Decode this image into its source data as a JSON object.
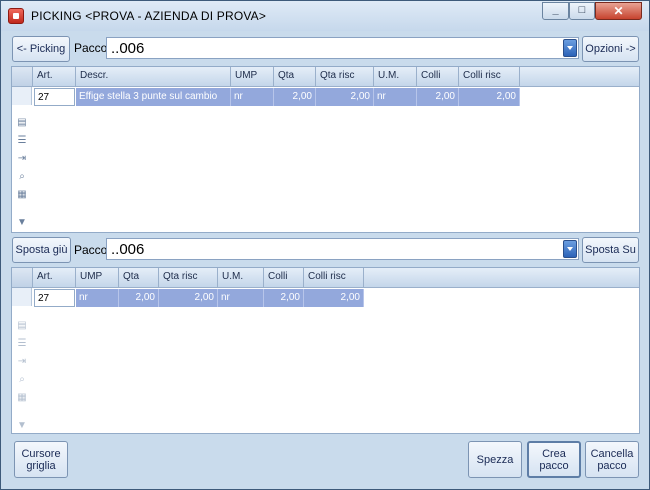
{
  "window": {
    "title": "PICKING <PROVA - AZIENDA DI PROVA>",
    "controls": {
      "minimize": "_",
      "maximize": "□",
      "close": "✕"
    }
  },
  "top": {
    "back_button": "<- Picking",
    "pacco_label": "Pacco",
    "pacco_value": "..006",
    "options_button": "Opzioni ->",
    "grid": {
      "columns": [
        "Art.",
        "Descr.",
        "UMP",
        "Qta",
        "Qta risc",
        "U.M.",
        "Colli",
        "Colli risc"
      ],
      "rows": [
        {
          "art": "27",
          "descr": "Effige stella 3 punte sul cambio",
          "ump": "nr",
          "qta": "2,00",
          "qta_risc": "2,00",
          "um": "nr",
          "colli": "2,00",
          "colli_risc": "2,00"
        }
      ]
    },
    "toolbar_icons": [
      "table-icon",
      "list-icon",
      "insert-icon",
      "search-icon",
      "columns-icon",
      "filter-icon"
    ]
  },
  "middle": {
    "move_down_button": "Sposta giù",
    "pacco_label": "Pacco",
    "pacco_value": "..006",
    "move_up_button": "Sposta Su"
  },
  "bottom": {
    "grid": {
      "columns": [
        "Art.",
        "UMP",
        "Qta",
        "Qta risc",
        "U.M.",
        "Colli",
        "Colli risc"
      ],
      "rows": [
        {
          "art": "27",
          "ump": "nr",
          "qta": "2,00",
          "qta_risc": "2,00",
          "um": "nr",
          "colli": "2,00",
          "colli_risc": "2,00"
        }
      ]
    },
    "toolbar_icons": [
      "table-icon",
      "list-icon",
      "insert-icon",
      "search-icon",
      "columns-icon",
      "filter-icon"
    ]
  },
  "footer": {
    "cursor_grid_button": "Cursore\ngriglia",
    "split_button": "Spezza",
    "create_pack_button": "Crea\npacco",
    "delete_pack_button": "Cancella\npacco"
  }
}
